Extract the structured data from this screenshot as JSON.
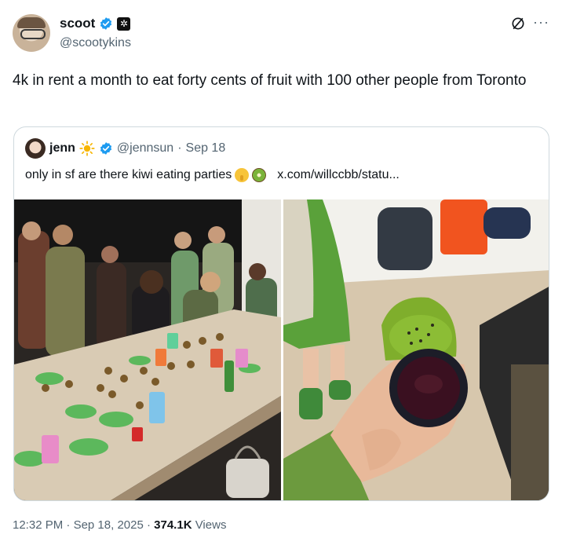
{
  "author": {
    "name": "scoot",
    "handle": "@scootykins",
    "verified_color": "#1d9bf0"
  },
  "tweet": {
    "text": "4k in rent a month to eat forty cents of fruit with 100 other people from Toronto"
  },
  "icons": {
    "grok": "grok-icon",
    "more": "more-options-icon",
    "more_glyph": "···",
    "affiliate": "affiliate-badge-icon",
    "affiliate_glyph": "✲"
  },
  "quoted": {
    "name": "jenn",
    "handle": "@jennsun",
    "separator": "·",
    "date": "Sep 18",
    "text": "only in sf are there kiwi eating parties",
    "link": "x.com/willccbb/statu..."
  },
  "footer": {
    "time": "12:32 PM",
    "sep1": " · ",
    "date": "Sep 18, 2025",
    "sep2": " · ",
    "views_count": "374.1K",
    "views_label": " Views"
  }
}
